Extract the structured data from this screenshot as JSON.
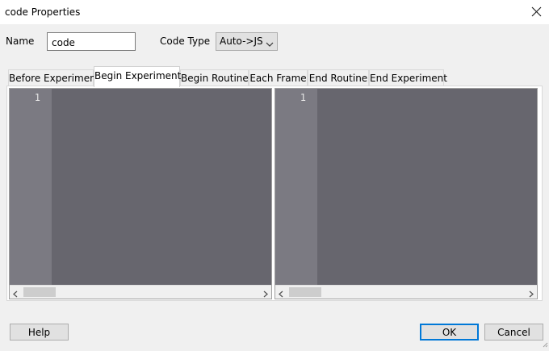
{
  "window": {
    "title": "code Properties"
  },
  "form": {
    "name_label": "Name",
    "name_value": "code",
    "code_type_label": "Code Type",
    "code_type_value": "Auto->JS"
  },
  "tabs": [
    {
      "label": "Before Experiment",
      "active": false
    },
    {
      "label": "Begin Experiment",
      "active": true
    },
    {
      "label": "Begin Routine",
      "active": false
    },
    {
      "label": "Each Frame",
      "active": false
    },
    {
      "label": "End Routine",
      "active": false
    },
    {
      "label": "End Experiment",
      "active": false
    }
  ],
  "editors": {
    "left": {
      "line_number": "1"
    },
    "right": {
      "line_number": "1"
    }
  },
  "buttons": {
    "help": "Help",
    "ok": "OK",
    "cancel": "Cancel"
  },
  "colors": {
    "editor_background": "#67666e",
    "gutter_background": "#7b7a82",
    "default_button_border": "#0078d7"
  }
}
